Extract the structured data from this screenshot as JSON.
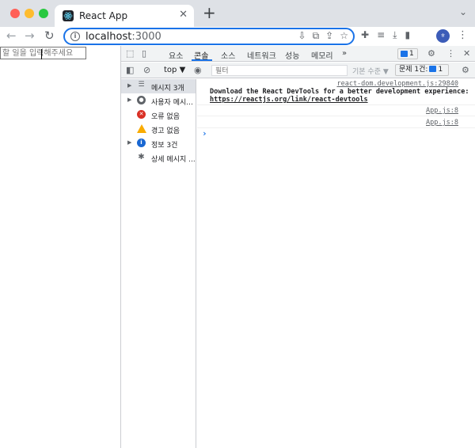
{
  "browser": {
    "tab_title": "React App",
    "tab_close": "✕",
    "new_tab": "+",
    "url_host": "localhost",
    "url_port": ":3000",
    "avatar_text": "ㅎ"
  },
  "page": {
    "input_placeholder": "할 일을 입력해주세요"
  },
  "devtools": {
    "tabs": [
      "요소",
      "콘솔",
      "소스",
      "네트워크",
      "성능",
      "메모리"
    ],
    "active_tab": "콘솔",
    "more_tabs": "»",
    "issue_count": "1",
    "context": "top ▼",
    "filter_placeholder": "필터",
    "levels": "기본 수준 ▼",
    "issues_label": "문제 1건:",
    "issues_count": "1",
    "sidebar": [
      {
        "label": "메시지 3개",
        "icon": "list-icon",
        "expandable": true,
        "selected": true
      },
      {
        "label": "사용자 메시...",
        "icon": "user-icon",
        "expandable": true,
        "selected": false
      },
      {
        "label": "오류 없음",
        "icon": "error-icon",
        "expandable": false,
        "selected": false
      },
      {
        "label": "경고 없음",
        "icon": "warning-icon",
        "expandable": false,
        "selected": false
      },
      {
        "label": "정보 3건",
        "icon": "info-icon",
        "expandable": true,
        "selected": false
      },
      {
        "label": "상세 메시지 ...",
        "icon": "bug-icon",
        "expandable": false,
        "selected": false
      }
    ],
    "console": {
      "devtools_source": "react-dom.development.js:29840",
      "devtools_message": "Download the React DevTools for a better development experience:",
      "devtools_link": "https://reactjs.org/link/react-devtools",
      "log_sources": [
        "App.js:8",
        "App.js:8"
      ],
      "prompt": "›"
    }
  },
  "colors": {
    "accent": "#1a73e8",
    "error": "#d93025",
    "warning": "#f9ab00",
    "info": "#1967d2"
  }
}
